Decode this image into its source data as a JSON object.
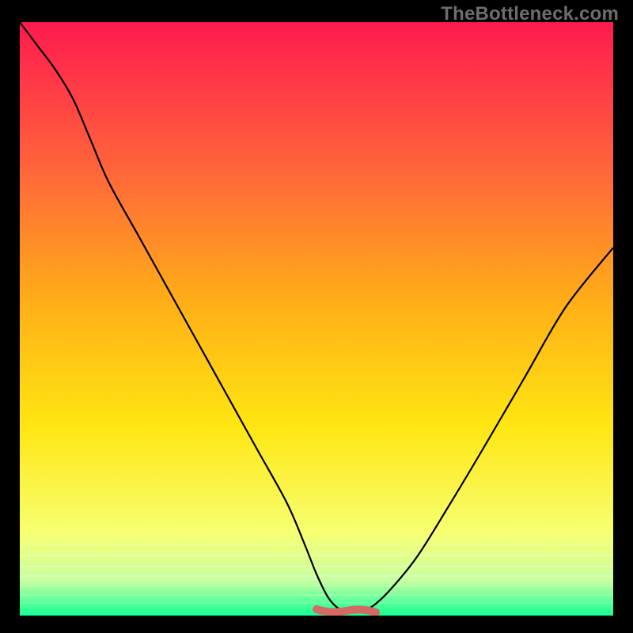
{
  "watermark": "TheBottleneck.com",
  "colors": {
    "page_bg": "#000000",
    "watermark_text": "#6d6d6d",
    "grad_top": "#ff1a4f",
    "grad_mid1": "#ff663a",
    "grad_mid2": "#ffb116",
    "grad_mid3": "#ffe612",
    "grad_low1": "#f7ff72",
    "grad_low2": "#c9ffa1",
    "grad_bottom": "#15ff95",
    "curve": "#000000",
    "marker": "#d46a64"
  },
  "chart_data": {
    "type": "line",
    "title": "",
    "xlabel": "",
    "ylabel": "",
    "xlim": [
      0,
      100
    ],
    "ylim": [
      0,
      100
    ],
    "legend": false,
    "grid": false,
    "x": [
      0,
      3,
      6,
      9,
      12,
      15,
      20,
      25,
      30,
      35,
      40,
      45,
      48,
      50,
      52,
      54,
      56,
      58,
      60,
      63,
      67,
      72,
      78,
      85,
      92,
      100
    ],
    "values": [
      100,
      96,
      92,
      87,
      80,
      73,
      64,
      55,
      46,
      37,
      28,
      19,
      12,
      7,
      3,
      1,
      0.5,
      0.8,
      2,
      5,
      10,
      18,
      28,
      40,
      52,
      62
    ],
    "annotations": [
      {
        "type": "marker_band",
        "x_start": 50,
        "x_end": 60,
        "y": 0.8
      }
    ]
  }
}
